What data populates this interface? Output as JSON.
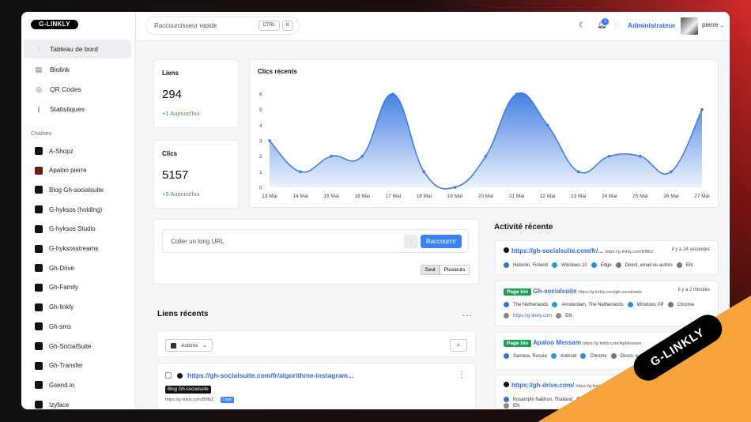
{
  "brand": "G-LINKLY",
  "sidebar": {
    "nav": [
      {
        "label": "Tableau de bord",
        "icon": "sliders-icon",
        "active": true
      },
      {
        "label": "Biolink",
        "icon": "page-icon"
      },
      {
        "label": "QR Codes",
        "icon": "qr-icon"
      },
      {
        "label": "Statistiques",
        "icon": "chart-icon"
      }
    ],
    "channels_title": "Chaînes",
    "channels": [
      {
        "label": "A-Shopz",
        "color": "#111111"
      },
      {
        "label": "Apaloo pierre",
        "color": "#6b1a1a"
      },
      {
        "label": "Blog Gh-socialsuite",
        "color": "#111111"
      },
      {
        "label": "G-hyksos (holding)",
        "color": "#111111"
      },
      {
        "label": "G-hyksos Studio",
        "color": "#111111"
      },
      {
        "label": "G-hyksosstreams",
        "color": "#111111"
      },
      {
        "label": "Gh-Drive",
        "color": "#111111"
      },
      {
        "label": "Gh-Family",
        "color": "#111111"
      },
      {
        "label": "Gh-linkly",
        "color": "#111111"
      },
      {
        "label": "Gh-sms",
        "color": "#111111"
      },
      {
        "label": "Gh-SocialSuite",
        "color": "#111111"
      },
      {
        "label": "Gh-Transfer",
        "color": "#111111"
      },
      {
        "label": "Gsend.io",
        "color": "#111111"
      },
      {
        "label": "Izyface",
        "color": "#111111"
      }
    ]
  },
  "topbar": {
    "search_placeholder": "Raccourcisseur rapide",
    "kbd_ctrl": "CTRL",
    "kbd_k": "K",
    "notif_count": "1",
    "role": "Administrateur",
    "user": "pierre"
  },
  "stats": {
    "links": {
      "title": "Liens",
      "value": "294",
      "delta": "+1 Aujourd'hui"
    },
    "clicks": {
      "title": "Clics",
      "value": "5157",
      "delta": "+5 Aujourd'hui"
    }
  },
  "chart_title": "Clics récents",
  "chart_data": {
    "type": "area",
    "x": [
      "13 Mai",
      "14 Mai",
      "15 Mai",
      "16 Mai",
      "17 Mai",
      "18 Mai",
      "19 Mai",
      "20 Mai",
      "21 Mai",
      "22 Mai",
      "23 Mai",
      "24 Mai",
      "25 Mai",
      "26 Mai",
      "27 Mai"
    ],
    "y": [
      3,
      1,
      2,
      2,
      6,
      1,
      0,
      2,
      6,
      4,
      1,
      2,
      2,
      1,
      5
    ],
    "ylim": [
      0,
      6
    ],
    "yticks": [
      "0",
      "1",
      "2",
      "3",
      "4",
      "5",
      "6"
    ],
    "color": "#3b7ae0"
  },
  "shortener": {
    "placeholder": "Coller un long URL",
    "button": "Raccourcir",
    "seg_single": "Seul",
    "seg_multi": "Plusieurs"
  },
  "recent_links": {
    "title": "Liens récents",
    "actions": "Actions",
    "item": {
      "url": "https://gh-socialsuite.com/fr/algorithme-instagram...",
      "tag": "Blog Gh-socialsuite",
      "short": "https://g-linkly.com/BMbZ",
      "copy": "Copie"
    }
  },
  "activity": {
    "title": "Activité récente",
    "items": [
      {
        "badge": "",
        "link": "https://gh-socialsuite.com/fr/...",
        "short": "https://g-linkly.com/BMbZ",
        "time": "il y a 24 secondes",
        "line1": [
          "Helsinki, Finland",
          "Windows 10",
          "Edge",
          "Direct, email ou autres",
          "EN"
        ],
        "line2": []
      },
      {
        "badge": "Page bio",
        "link": "Gh-socialsuite",
        "short": "https://g-linkly.com/gh-socialsuite",
        "time": "il y a 2 minutes",
        "line1": [
          "The Netherlands",
          "Amsterdam, The Netherlands",
          "Windows XP",
          "Chrome"
        ],
        "line2": [
          "https://g-linkly.com",
          "EN"
        ]
      },
      {
        "badge": "Page bio",
        "link": "Apaloo Messam",
        "short": "https://g-linkly.com/ApMessam",
        "time": "",
        "line1": [
          "Samara, Russia",
          "Android",
          "Chrome",
          "Direct, e..."
        ],
        "line2": []
      },
      {
        "badge": "",
        "link": "https://gh-drive.com/",
        "short": "https://g-linkly.co...",
        "time": "",
        "line1": [
          "Kosamphi Nakhon, Thailand",
          "Wi..."
        ],
        "line2": [
          "EN"
        ]
      }
    ]
  }
}
